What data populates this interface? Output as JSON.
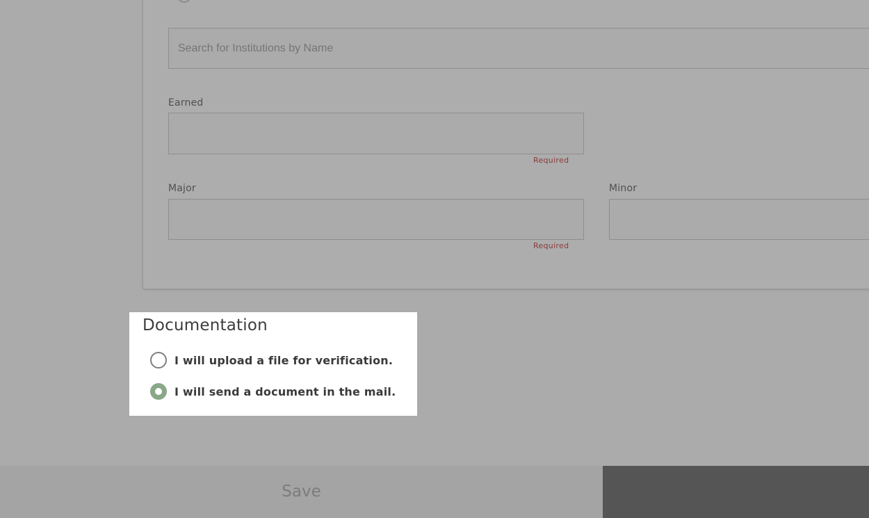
{
  "form": {
    "institution_search": {
      "value": "",
      "placeholder": "Search for Institutions by Name"
    },
    "earned": {
      "label": "Earned",
      "value": "",
      "required_text": "Required"
    },
    "major": {
      "label": "Major",
      "value": "",
      "required_text": "Required"
    },
    "minor": {
      "label": "Minor",
      "value": ""
    }
  },
  "documentation": {
    "title": "Documentation",
    "options": [
      {
        "label": "I will upload a file for verification.",
        "selected": false
      },
      {
        "label": "I will send a document in the mail.",
        "selected": true
      }
    ]
  },
  "footer": {
    "save_label": "Save",
    "secondary_label": ""
  },
  "colors": {
    "overlay_bg": "#ababab",
    "accent_radio": "#8aa888",
    "required_text": "#8a3a3a",
    "dark_button": "#555555"
  }
}
